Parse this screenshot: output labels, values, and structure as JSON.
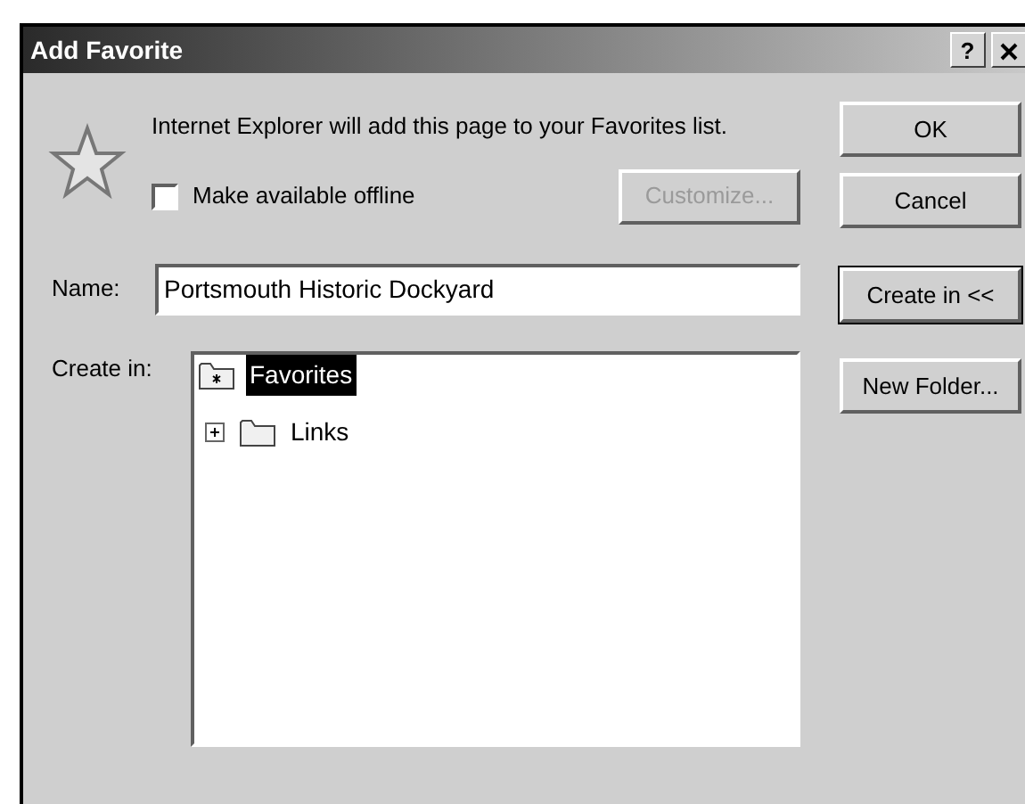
{
  "window": {
    "title": "Add Favorite",
    "help_label": "?"
  },
  "message": "Internet Explorer will add this page to your Favorites list.",
  "offline": {
    "label": "Make available offline",
    "checked": false
  },
  "customize": {
    "label": "Customize...",
    "disabled": true
  },
  "name": {
    "label": "Name:",
    "value": "Portsmouth Historic Dockyard"
  },
  "create_in": {
    "label": "Create in:",
    "tree": [
      {
        "label": "Favorites",
        "selected": true,
        "children": [
          {
            "label": "Links",
            "selected": false,
            "expanded": false
          }
        ]
      }
    ]
  },
  "buttons": [
    {
      "label": "OK",
      "default": false
    },
    {
      "label": "Cancel",
      "default": false
    },
    {
      "label": "Create in <<",
      "default": true
    },
    {
      "label": "New Folder...",
      "default": false
    }
  ]
}
